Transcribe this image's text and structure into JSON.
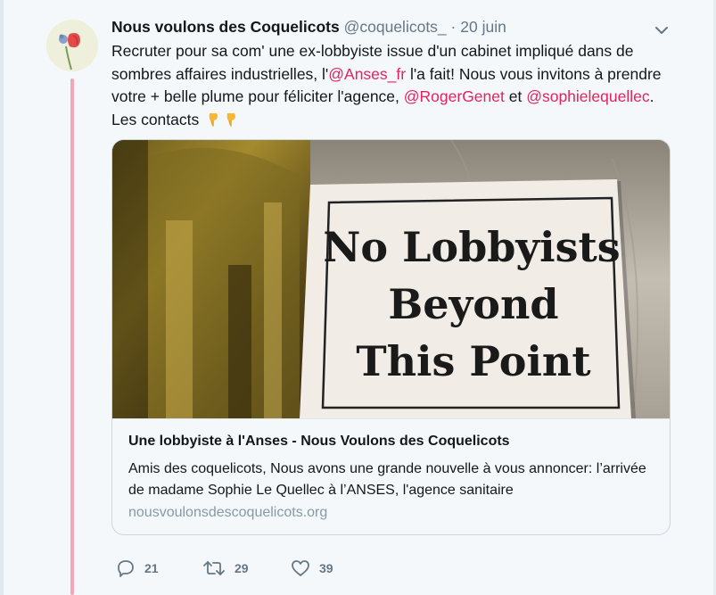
{
  "tweet": {
    "author_name": "Nous voulons des Coquelicots",
    "handle": "@coquelicots_",
    "separator": "·",
    "date": "20 juin",
    "text": {
      "part1": "Recruter pour sa com' une ex-lobbyiste issue d'un cabinet impliqué dans de sombres affaires industrielles, l'",
      "mention1": "@Anses_fr",
      "part2": " l'a fait! Nous vous invitons à prendre votre + belle plume pour féliciter l'agence, ",
      "mention2": "@RogerGenet",
      "part3": " et ",
      "mention3": "@sophielequellec",
      "part4": ". Les contacts "
    },
    "emojis": [
      "pointing-down-emoji",
      "pointing-down-emoji"
    ]
  },
  "card": {
    "image_sign_lines": [
      "No Lobbyists",
      "Beyond",
      "This Point"
    ],
    "title": "Une lobbyiste à l'Anses - Nous Voulons des Coquelicots",
    "description": "Amis des coquelicots, Nous avons une grande nouvelle à vous annoncer: l’arrivée de madame Sophie Le Quellec à l’ANSES, l'agence sanitaire",
    "domain": "nousvoulonsdescoquelicots.org"
  },
  "actions": {
    "reply_count": "21",
    "retweet_count": "29",
    "like_count": "39"
  },
  "colors": {
    "mention": "#e0245e",
    "thread_line": "#f4a6b8",
    "secondary_text": "#657786"
  }
}
